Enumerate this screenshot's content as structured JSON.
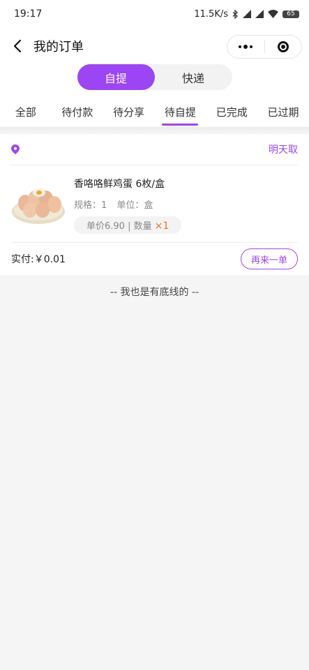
{
  "status": {
    "time": "19:17",
    "speed": "11.5K/s",
    "battery": "65"
  },
  "nav": {
    "title": "我的订单",
    "back_icon": "chevron-left-icon",
    "more_icon": "more-dots-icon",
    "close_icon": "target-icon"
  },
  "segment": {
    "options": [
      "自提",
      "快递"
    ],
    "active": "自提"
  },
  "tabs": {
    "items": [
      "全部",
      "待付款",
      "待分享",
      "待自提",
      "已完成",
      "已过期"
    ],
    "active": "待自提"
  },
  "order": {
    "pickup_icon": "location-pin-icon",
    "pickup_time": "明天取",
    "product": {
      "name": "香咯咯鲜鸡蛋 6枚/盒",
      "spec": "规格：1",
      "unit": "单位：盒",
      "price_label": "单价6.90 | 数量",
      "qty": "×1"
    },
    "paid": "实付:￥0.01",
    "reorder_label": "再来一单"
  },
  "footer_text": "-- 我也是有底线的 --",
  "colors": {
    "accent": "#9b45f5",
    "qty": "#f0732b",
    "background": "#f5f5f5"
  }
}
